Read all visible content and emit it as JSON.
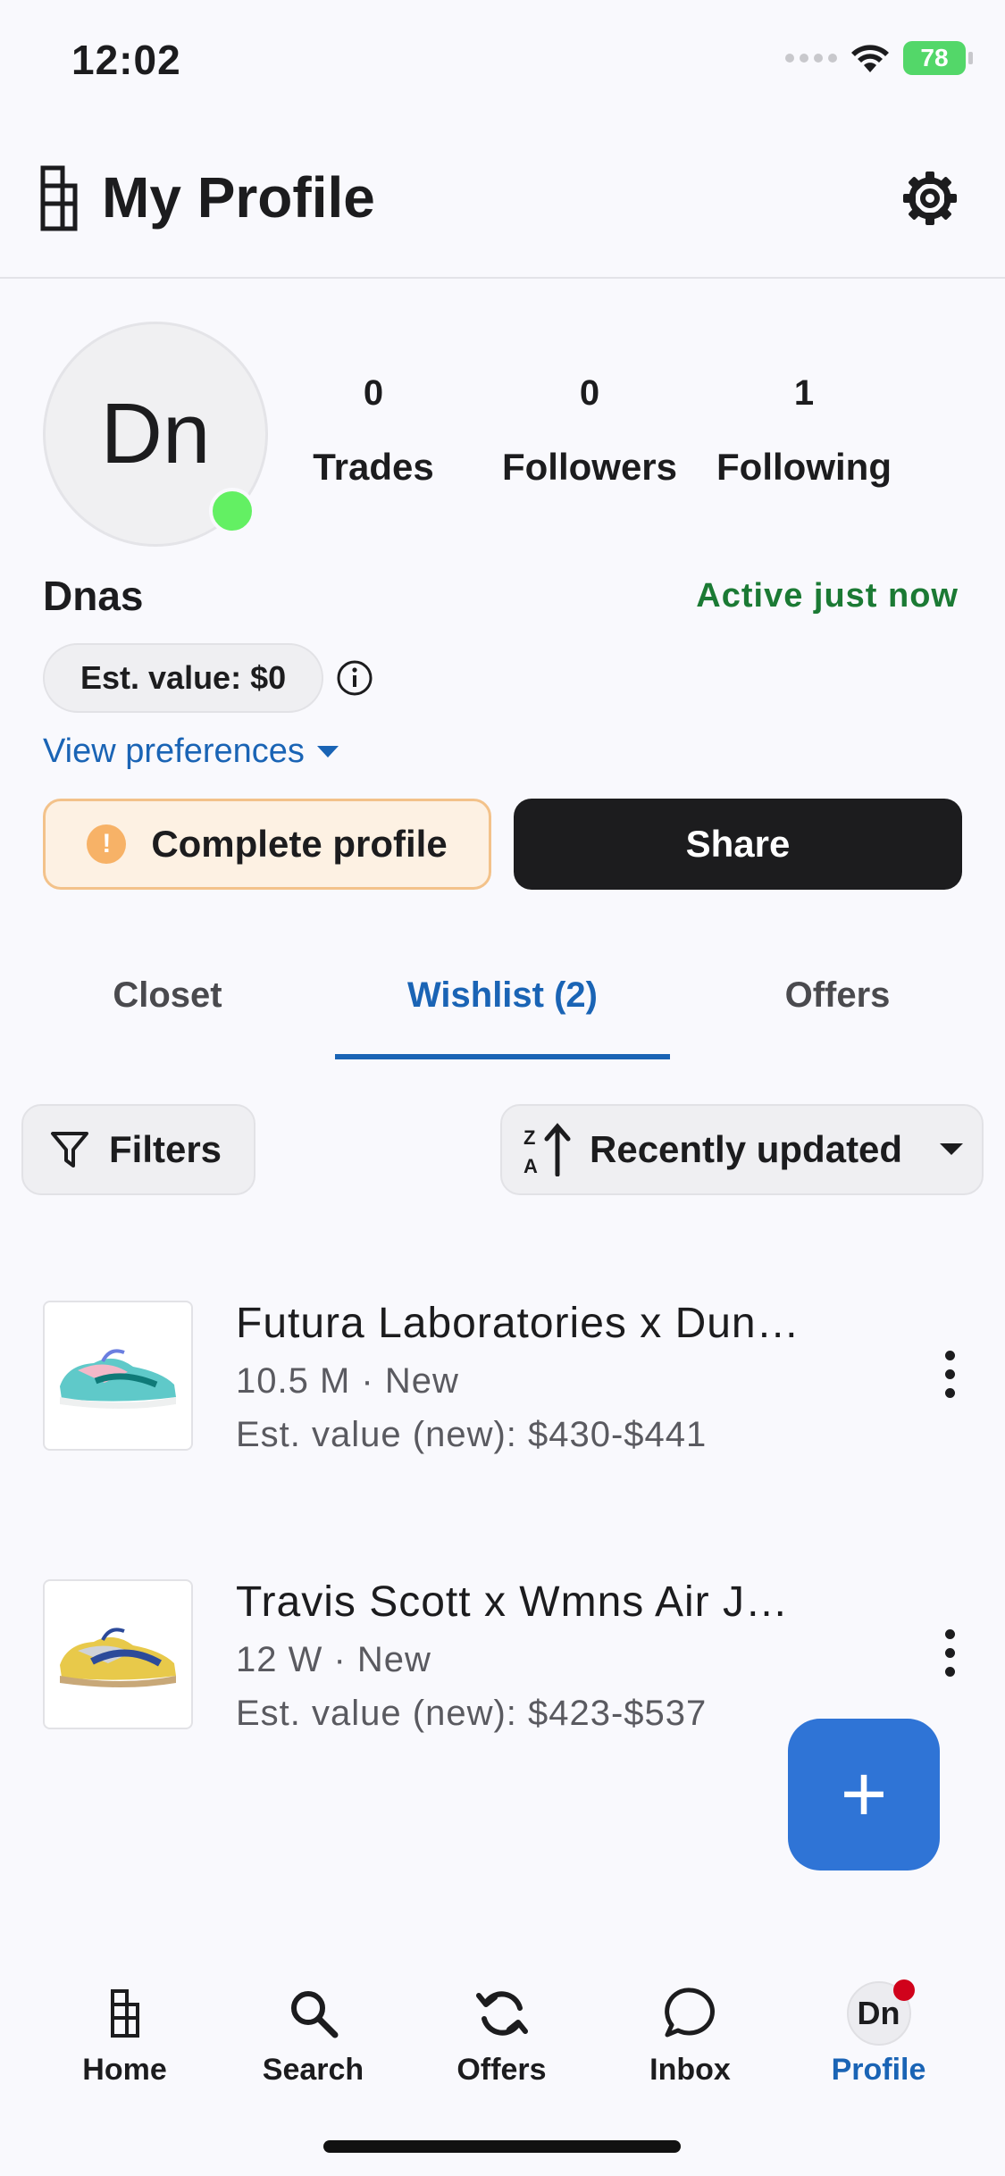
{
  "status_bar": {
    "time": "12:02",
    "battery": "78"
  },
  "header": {
    "title": "My Profile"
  },
  "profile": {
    "initials": "Dn",
    "username": "Dnas",
    "activity": "Active just now",
    "est_value": "Est. value: $0",
    "view_preferences": "View preferences",
    "stats": [
      {
        "value": "0",
        "label": "Trades"
      },
      {
        "value": "0",
        "label": "Followers"
      },
      {
        "value": "1",
        "label": "Following"
      }
    ],
    "complete_profile_label": "Complete profile",
    "share_label": "Share"
  },
  "tabs": [
    {
      "label": "Closet"
    },
    {
      "label": "Wishlist (2)"
    },
    {
      "label": "Offers"
    }
  ],
  "toolbar": {
    "filters_label": "Filters",
    "sort_label": "Recently updated"
  },
  "items": [
    {
      "title": "Futura Laboratories x Dun…",
      "sub": "10.5 M · New",
      "est": "Est. value (new): $430-$441"
    },
    {
      "title": "Travis Scott x Wmns Air J…",
      "sub": "12 W · New",
      "est": "Est. value (new): $423-$537"
    }
  ],
  "fab": {
    "label": "+"
  },
  "bottom_nav": [
    {
      "label": "Home"
    },
    {
      "label": "Search"
    },
    {
      "label": "Offers"
    },
    {
      "label": "Inbox"
    },
    {
      "label": "Profile",
      "avatar": "Dn"
    }
  ],
  "colors": {
    "accent": "#1a64b5",
    "active_green": "#1b7a34",
    "fab": "#2f74d6",
    "warning": "#f7b267"
  }
}
